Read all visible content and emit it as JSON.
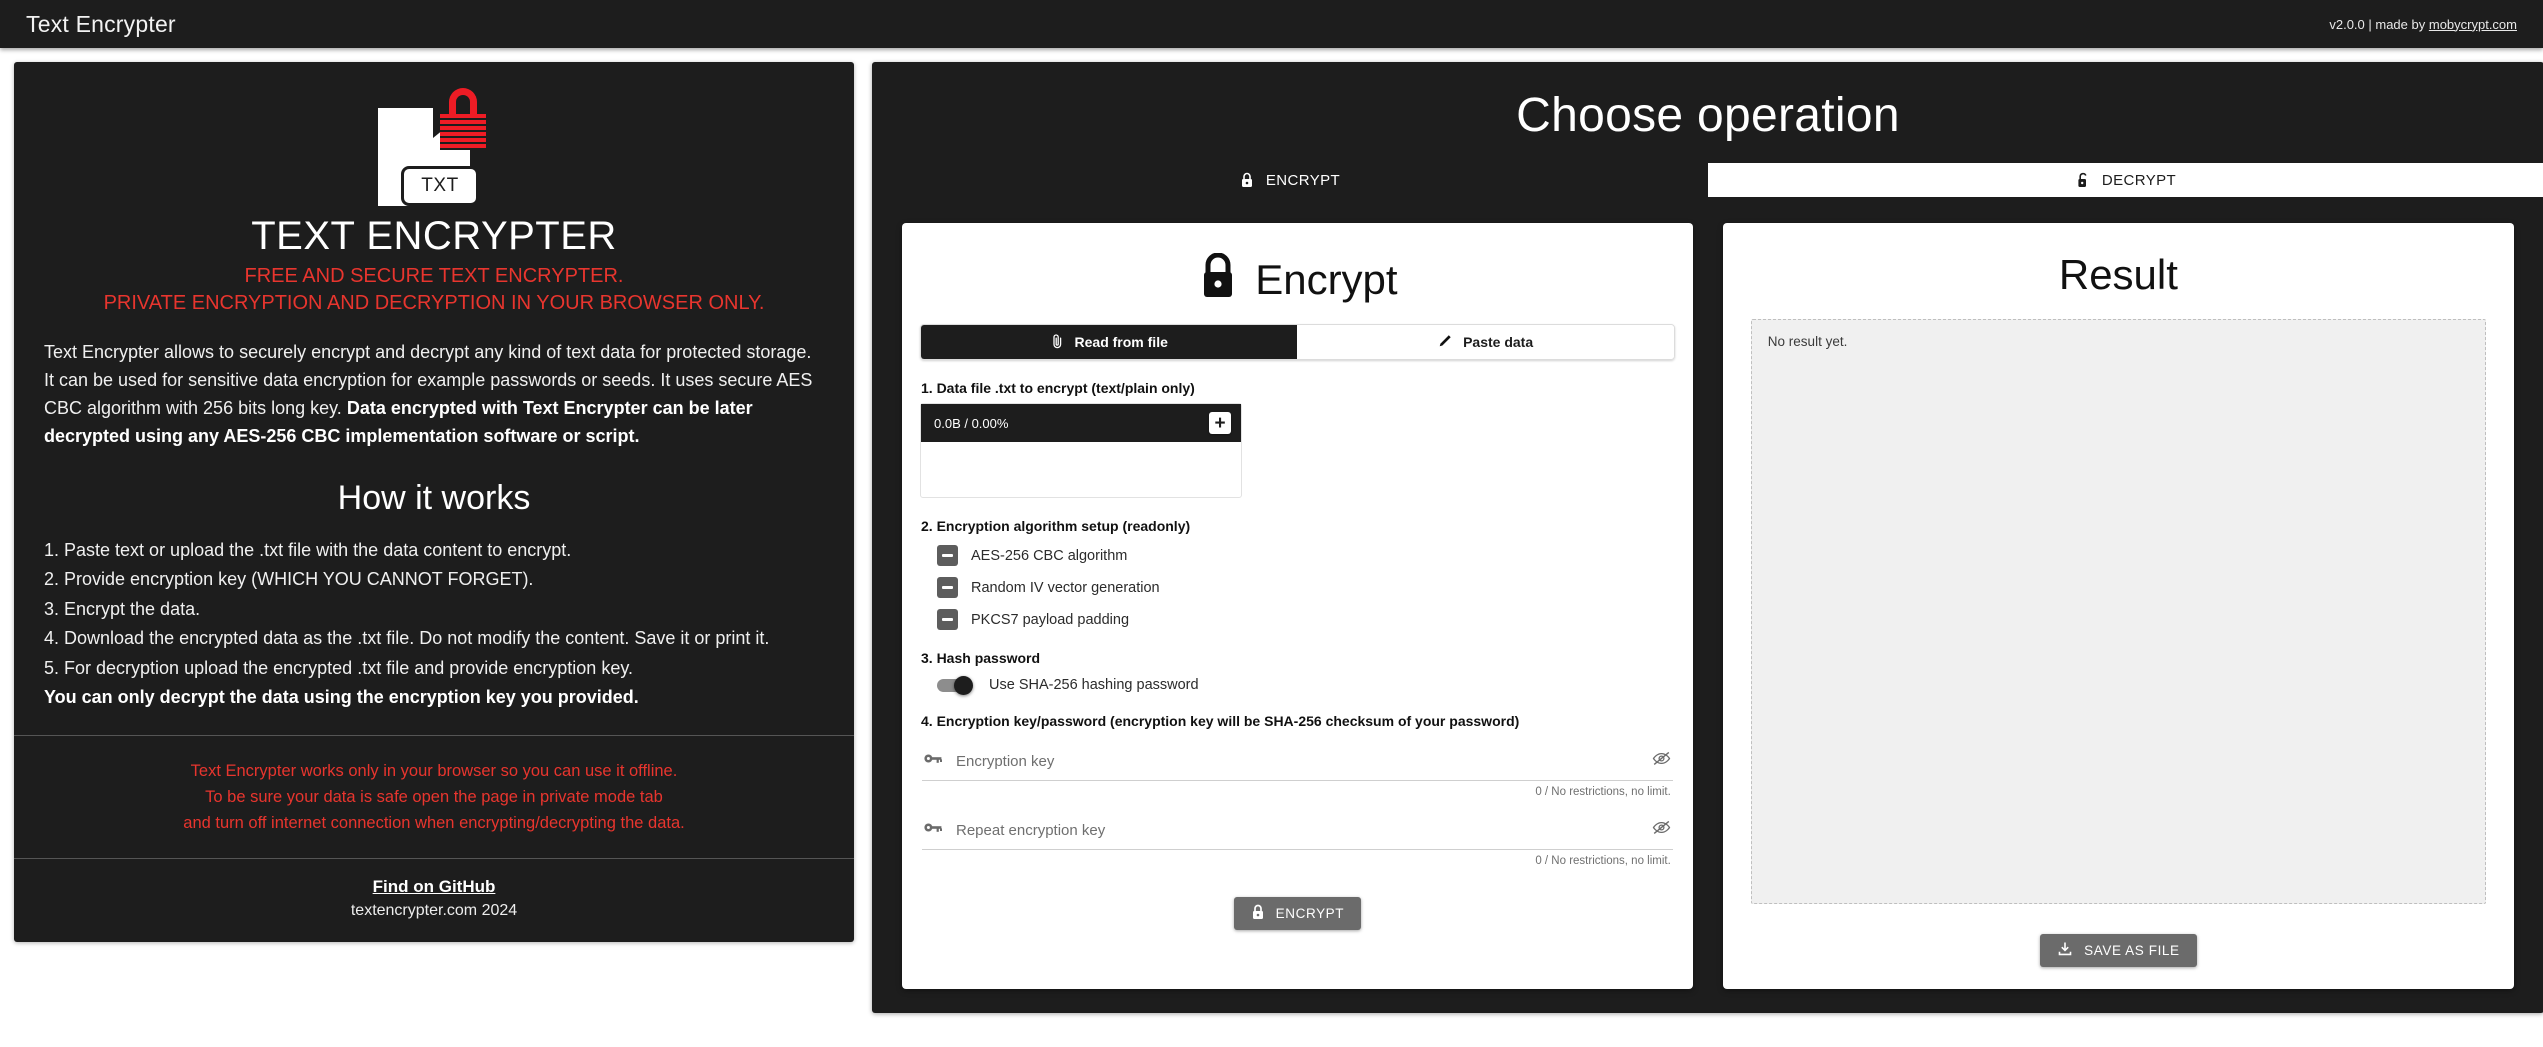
{
  "topbar": {
    "title": "Text Encrypter",
    "version_prefix": "v2.0.0 | made by ",
    "author_link": "mobycrypt.com"
  },
  "sidebar": {
    "logo_badge_text": "TXT",
    "brand_title": "TEXT ENCRYPTER",
    "tagline_line1": "FREE AND SECURE TEXT ENCRYPTER.",
    "tagline_line2": "PRIVATE ENCRYPTION AND DECRYPTION IN YOUR BROWSER ONLY.",
    "description": "Text Encrypter allows to securely encrypt and decrypt any kind of text data for protected storage. It can be used for sensitive data encryption for example passwords or seeds. It uses secure AES CBC algorithm with 256 bits long key.",
    "description_bold": "Data encrypted with Text Encrypter can be later decrypted using any AES-256 CBC implementation software or script.",
    "how_it_works_title": "How it works",
    "steps": [
      "1. Paste text or upload the .txt file with the data content to encrypt.",
      "2. Provide encryption key (WHICH YOU CANNOT FORGET).",
      "3. Encrypt the data.",
      "4. Download the encrypted data as the .txt file. Do not modify the content. Save it or print it.",
      "5. For decryption upload the encrypted .txt file and provide encryption key."
    ],
    "steps_bold": "You can only decrypt the data using the encryption key you provided.",
    "warning_line1": "Text Encrypter works only in your browser so you can use it offline.",
    "warning_line2": "To be sure your data is safe open the page in private mode tab",
    "warning_line3": "and turn off internet connection when encrypting/decrypting the data.",
    "github_link": "Find on GitHub",
    "copyright": "textencrypter.com 2024"
  },
  "main": {
    "title": "Choose operation",
    "op_tabs": [
      {
        "label": "ENCRYPT",
        "icon": "lock-icon",
        "active": true
      },
      {
        "label": "DECRYPT",
        "icon": "unlock-icon",
        "active": false
      }
    ]
  },
  "encrypt_card": {
    "title": "Encrypt",
    "source_tabs": [
      {
        "label": "Read from file",
        "icon": "paperclip-icon",
        "active": true
      },
      {
        "label": "Paste data",
        "icon": "pencil-icon",
        "active": false
      }
    ],
    "step1_label": "1. Data file .txt to encrypt (text/plain only)",
    "file_progress": "0.0B / 0.00%",
    "add_file_glyph": "+",
    "step2_label": "2. Encryption algorithm setup (readonly)",
    "algorithms": [
      "AES-256 CBC algorithm",
      "Random IV vector generation",
      "PKCS7 payload padding"
    ],
    "step3_label": "3. Hash password",
    "hash_toggle_label": "Use SHA-256 hashing password",
    "hash_toggle_on": true,
    "step4_label": "4. Encryption key/password (encryption key will be SHA-256 checksum of your password)",
    "key_field": {
      "placeholder": "Encryption key",
      "value": "",
      "counter": "0 / No restrictions, no limit."
    },
    "repeat_key_field": {
      "placeholder": "Repeat encryption key",
      "value": "",
      "counter": "0 / No restrictions, no limit."
    },
    "submit_label": "ENCRYPT"
  },
  "result_card": {
    "title": "Result",
    "empty_text": "No result yet.",
    "save_label": "SAVE AS FILE"
  },
  "colors": {
    "dark": "#1d1d1d",
    "accent_red": "#e8352e",
    "logo_red": "#ee1c25",
    "disabled_grey": "#6b6b6b"
  }
}
